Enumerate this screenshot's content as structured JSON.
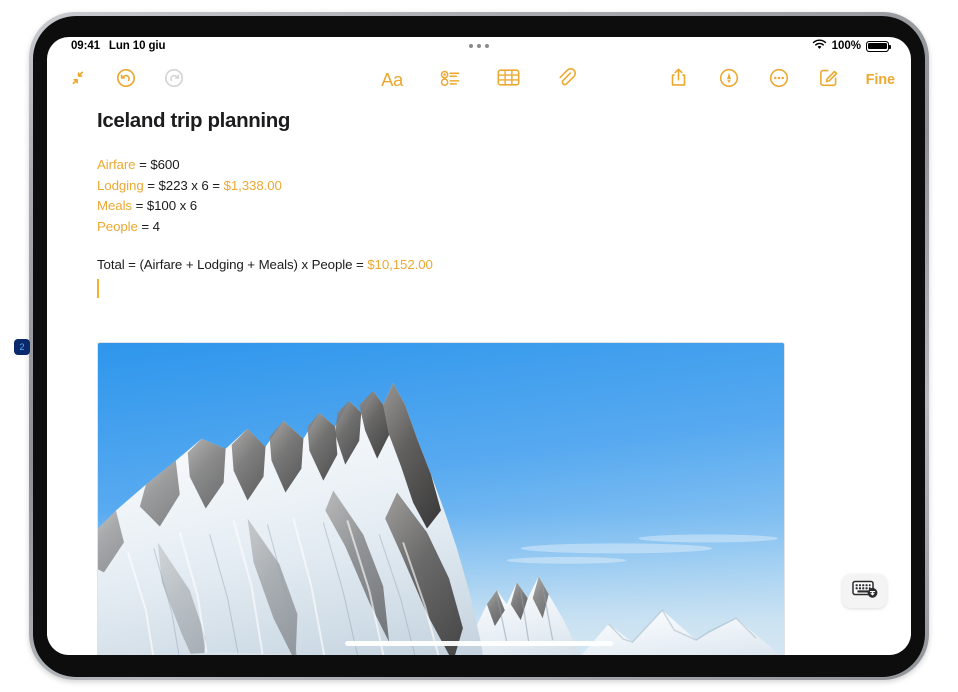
{
  "device": {
    "annotation_marker": "2"
  },
  "status_bar": {
    "time": "09:41",
    "date": "Lun 10 giu",
    "wifi_icon": "wifi-icon",
    "battery_percent": "100%",
    "battery_icon": "battery-full-icon",
    "multitask_handle": "multitasking-dots"
  },
  "toolbar": {
    "left": [
      {
        "name": "collapse-button",
        "icon": "arrows-collapse-icon",
        "state": "enabled"
      },
      {
        "name": "undo-button",
        "icon": "undo-circle-icon",
        "state": "enabled"
      },
      {
        "name": "redo-button",
        "icon": "redo-circle-icon",
        "state": "disabled"
      }
    ],
    "center": [
      {
        "name": "format-button",
        "icon": "aa-text-format-icon",
        "label": "Aa"
      },
      {
        "name": "checklist-button",
        "icon": "checklist-icon"
      },
      {
        "name": "table-button",
        "icon": "table-grid-icon"
      },
      {
        "name": "attach-button",
        "icon": "paperclip-icon"
      }
    ],
    "right": [
      {
        "name": "share-button",
        "icon": "share-up-arrow-icon"
      },
      {
        "name": "markup-button",
        "icon": "markup-pen-circle-icon"
      },
      {
        "name": "more-button",
        "icon": "ellipsis-circle-icon"
      },
      {
        "name": "compose-button",
        "icon": "compose-pencil-square-icon"
      }
    ],
    "done_label": "Fine"
  },
  "note": {
    "title": "Iceland trip planning",
    "lines": [
      {
        "var": "Airfare",
        "eq": " = ",
        "expr": "$600",
        "result": ""
      },
      {
        "var": "Lodging",
        "eq": " = ",
        "expr": "$223 x 6  = ",
        "result": "$1,338.00"
      },
      {
        "var": "Meals",
        "eq": " = ",
        "expr": "$100 x 6",
        "result": ""
      },
      {
        "var": "People",
        "eq": " = ",
        "expr": "4",
        "result": ""
      }
    ],
    "total": {
      "expr": "Total = (Airfare + Lodging + Meals)  x People  = ",
      "result": "$10,152.00"
    },
    "photo": {
      "name": "iceland-mountain-photo",
      "alt": "Snow covered mountain under blue sky",
      "sky_color": "#4aa3ef",
      "rock_color": "#5b5b5e",
      "snow_color": "#e9eef4"
    }
  },
  "floating": {
    "keyboard_dismiss": {
      "name": "keyboard-dismiss-button",
      "icon": "keyboard-dismiss-icon"
    }
  },
  "colors": {
    "accent_orange": "#ECA932",
    "caret": "#F0B32B",
    "text": "#1c1c1e",
    "disabled": "#d4d4d6"
  }
}
